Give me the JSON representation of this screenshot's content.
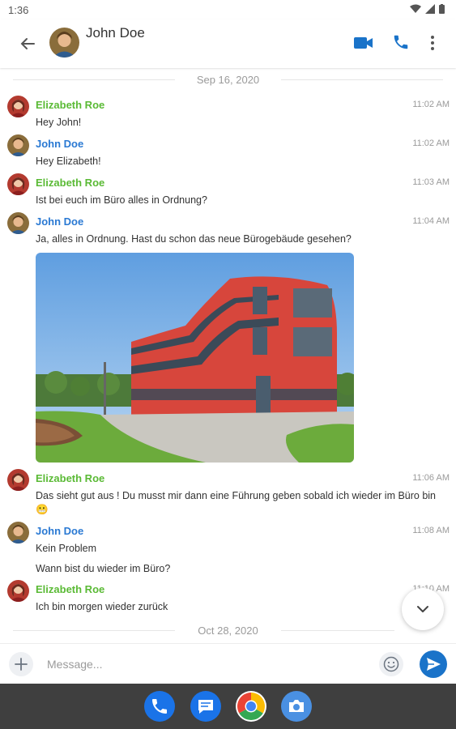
{
  "status_bar": {
    "time": "1:36"
  },
  "header": {
    "contact_name": "John Doe"
  },
  "date_separators": [
    "Sep 16, 2020",
    "Oct 28, 2020"
  ],
  "messages": [
    {
      "sender": "Elizabeth Roe",
      "time": "11:02 AM",
      "lines": [
        "Hey John!"
      ]
    },
    {
      "sender": "John Doe",
      "time": "11:02 AM",
      "lines": [
        "Hey Elizabeth!"
      ]
    },
    {
      "sender": "Elizabeth Roe",
      "time": "11:03 AM",
      "lines": [
        "Ist bei euch im Büro alles in Ordnung?"
      ]
    },
    {
      "sender": "John Doe",
      "time": "11:04 AM",
      "lines": [
        "Ja, alles in Ordnung. Hast du schon das neue Bürogebäude gesehen?"
      ]
    },
    {
      "sender": "Elizabeth Roe",
      "time": "11:06 AM",
      "lines": [
        "Das sieht gut aus ! Du musst mir dann eine Führung geben sobald ich wieder im Büro bin",
        "😬"
      ]
    },
    {
      "sender": "John Doe",
      "time": "11:08 AM",
      "lines": [
        "Kein Problem",
        "Wann bist du wieder im Büro?"
      ]
    },
    {
      "sender": "Elizabeth Roe",
      "time": "11:10 AM",
      "lines": [
        "Ich bin morgen wieder zurück"
      ]
    }
  ],
  "composer": {
    "placeholder": "Message..."
  },
  "colors": {
    "accent": "#1a73c9",
    "sender_elizabeth": "#5aba35",
    "sender_john": "#2a79d3",
    "dock": "#3f3f3f"
  },
  "icons": {
    "back": "arrow-left-icon",
    "video": "video-camera-icon",
    "call": "phone-icon",
    "more": "more-vertical-icon",
    "scroll_down": "chevron-down-icon",
    "add": "plus-icon",
    "emoji": "smiley-icon",
    "send": "send-icon",
    "dock": [
      "phone-app-icon",
      "messages-app-icon",
      "chrome-app-icon",
      "camera-app-icon"
    ]
  }
}
